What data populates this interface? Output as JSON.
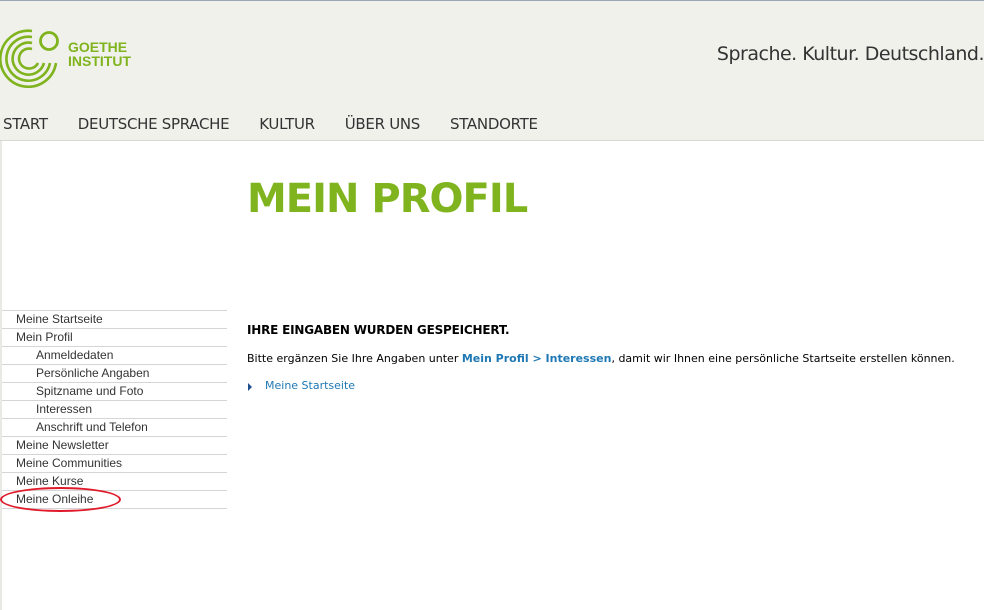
{
  "brand": {
    "logo_line1": "GOETHE",
    "logo_line2": "INSTITUT",
    "tagline": "Sprache. Kultur. Deutschland."
  },
  "mainnav": {
    "items": [
      "START",
      "DEUTSCHE SPRACHE",
      "KULTUR",
      "ÜBER UNS",
      "STANDORTE"
    ]
  },
  "page": {
    "title": "MEIN PROFIL"
  },
  "sidebar": {
    "items": [
      {
        "label": "Meine Startseite"
      },
      {
        "label": "Mein Profil"
      },
      {
        "label": "Anmeldedaten"
      },
      {
        "label": "Persönliche Angaben"
      },
      {
        "label": "Spitzname und Foto"
      },
      {
        "label": "Interessen"
      },
      {
        "label": "Anschrift und Telefon"
      },
      {
        "label": "Meine Newsletter"
      },
      {
        "label": "Meine Communities"
      },
      {
        "label": "Meine Kurse"
      },
      {
        "label": "Meine Onleihe"
      }
    ]
  },
  "content": {
    "heading": "IHRE EINGABEN WURDEN GESPEICHERT.",
    "body_before": "Bitte ergänzen Sie Ihre Angaben unter ",
    "body_link": "Mein Profil > Interessen",
    "body_after": ", damit wir Ihnen eine persönliche Startseite erstellen können.",
    "back_link": "Meine Startseite"
  },
  "colors": {
    "brand_green": "#7fb41e",
    "link_blue": "#1e78b4",
    "highlight_red": "#e01a2a"
  },
  "icons": {
    "logo": "goethe-logo-mark",
    "bullet": "arrow-right-icon"
  }
}
